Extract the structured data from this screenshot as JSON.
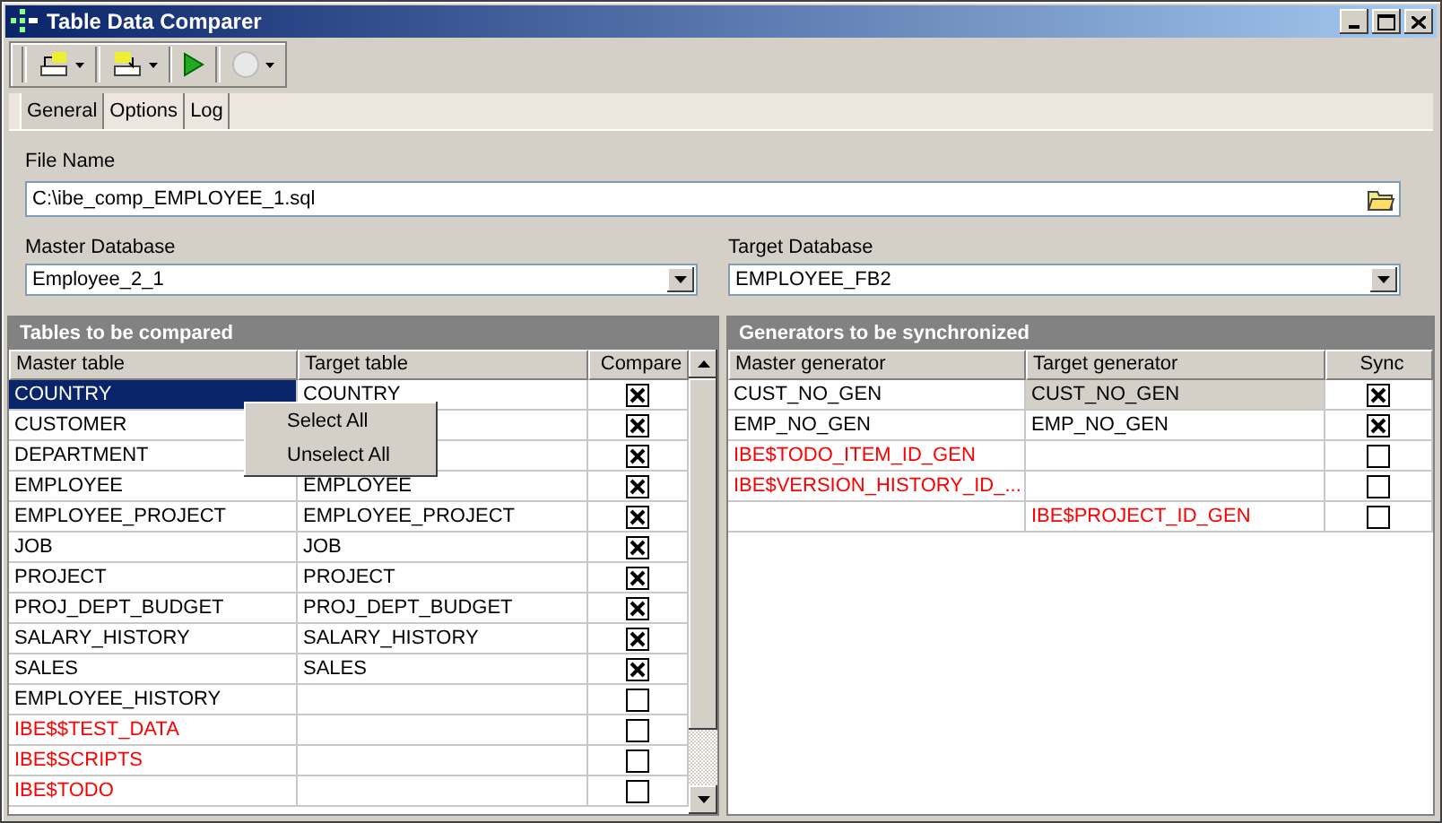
{
  "window": {
    "title": "Table Data Comparer"
  },
  "tabs": [
    {
      "label": "General",
      "selected": true
    },
    {
      "label": "Options",
      "selected": false
    },
    {
      "label": "Log",
      "selected": false
    }
  ],
  "file_name": {
    "label": "File Name",
    "value": "C:\\ibe_comp_EMPLOYEE_1.sql"
  },
  "master_database": {
    "label": "Master Database",
    "value": "Employee_2_1"
  },
  "target_database": {
    "label": "Target Database",
    "value": "EMPLOYEE_FB2"
  },
  "tables": {
    "title": "Tables to be compared",
    "active": true,
    "columns": [
      "Master table",
      "Target table",
      "Compare"
    ],
    "rows": [
      {
        "master": "COUNTRY",
        "target": "COUNTRY",
        "checked": true,
        "kind": "matched",
        "selected": true
      },
      {
        "master": "CUSTOMER",
        "checked": true,
        "kind": "matched",
        "selected": false
      },
      {
        "master": "DEPARTMENT",
        "checked": true,
        "kind": "matched",
        "selected": false
      },
      {
        "master": "EMPLOYEE",
        "target": "EMPLOYEE",
        "checked": true,
        "kind": "matched",
        "selected": false
      },
      {
        "master": "EMPLOYEE_PROJECT",
        "target": "EMPLOYEE_PROJECT",
        "checked": true,
        "kind": "matched",
        "selected": false
      },
      {
        "master": "JOB",
        "target": "JOB",
        "checked": true,
        "kind": "matched",
        "selected": false
      },
      {
        "master": "PROJECT",
        "target": "PROJECT",
        "checked": true,
        "kind": "matched",
        "selected": false
      },
      {
        "master": "PROJ_DEPT_BUDGET",
        "target": "PROJ_DEPT_BUDGET",
        "checked": true,
        "kind": "matched",
        "selected": false
      },
      {
        "master": "SALARY_HISTORY",
        "target": "SALARY_HISTORY",
        "checked": true,
        "kind": "matched",
        "selected": false
      },
      {
        "master": "SALES",
        "target": "SALES",
        "checked": true,
        "kind": "matched",
        "selected": false
      },
      {
        "master": "EMPLOYEE_HISTORY",
        "checked": false,
        "kind": "matched",
        "selected": false
      },
      {
        "master": "IBE$$TEST_DATA",
        "checked": false,
        "kind": "unmatched",
        "selected": false
      },
      {
        "master": "IBE$SCRIPTS",
        "checked": false,
        "kind": "unmatched",
        "selected": false
      },
      {
        "master": "IBE$TODO",
        "checked": false,
        "kind": "unmatched",
        "selected": false
      }
    ]
  },
  "generators": {
    "title": "Generators to be synchronized",
    "active": false,
    "columns": [
      "Master generator",
      "Target generator",
      "Sync"
    ],
    "rows": [
      {
        "master": "CUST_NO_GEN",
        "target": "CUST_NO_GEN",
        "checked": true,
        "kind": "matched",
        "selected": true
      },
      {
        "master": "EMP_NO_GEN",
        "target": "EMP_NO_GEN",
        "checked": true,
        "kind": "matched",
        "selected": false
      },
      {
        "master": "IBE$TODO_ITEM_ID_GEN",
        "checked": false,
        "kind": "unmatched",
        "selected": false
      },
      {
        "master": "IBE$VERSION_HISTORY_ID_...",
        "checked": false,
        "kind": "unmatched",
        "selected": false
      },
      {
        "target": "IBE$PROJECT_ID_GEN",
        "checked": false,
        "kind": "unmatched",
        "selected": false
      }
    ]
  },
  "context_menu": {
    "items": [
      "Select All",
      "Unselect All"
    ]
  }
}
